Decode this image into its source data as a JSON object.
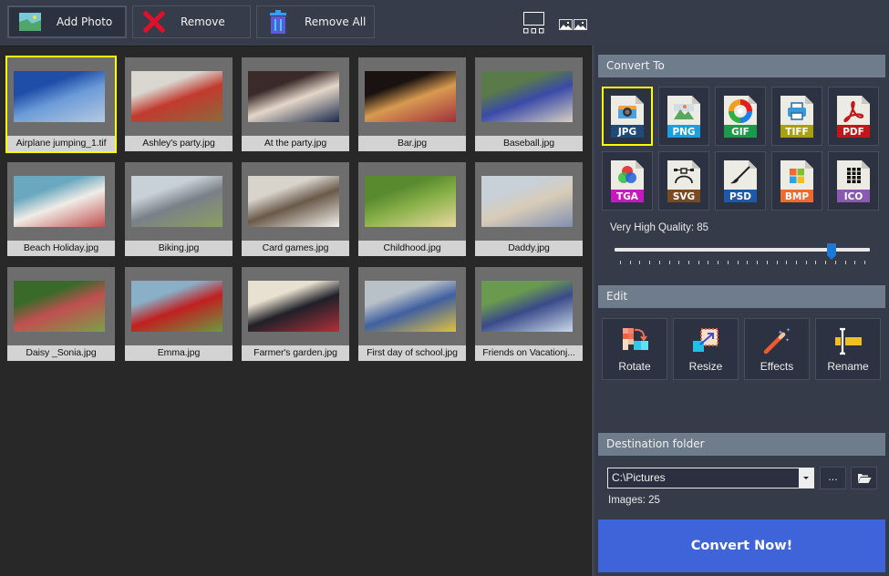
{
  "toolbar": {
    "add_photo": "Add Photo",
    "remove": "Remove",
    "remove_all": "Remove All",
    "view_icons": [
      "single-view-icon",
      "grid-view-icon"
    ]
  },
  "gallery": {
    "selected_index": 0,
    "items": [
      {
        "name": "Airplane jumping_1.tif",
        "colors": [
          "#1f4ea8",
          "#6c9bd8",
          "#b7c8e0"
        ]
      },
      {
        "name": "Ashley's party.jpg",
        "colors": [
          "#d9d7cf",
          "#c23a2e",
          "#8a6a3a"
        ]
      },
      {
        "name": "At the party.jpg",
        "colors": [
          "#3a2a2a",
          "#e4d6c8",
          "#1a2a4a"
        ]
      },
      {
        "name": "Bar.jpg",
        "colors": [
          "#1a1210",
          "#d89a50",
          "#a03040"
        ]
      },
      {
        "name": "Baseball.jpg",
        "colors": [
          "#5a7a4a",
          "#3a4aa8",
          "#d8d0c0"
        ]
      },
      {
        "name": "Beach Holiday.jpg",
        "colors": [
          "#6aa8c0",
          "#f0ece6",
          "#c05050"
        ]
      },
      {
        "name": "Biking.jpg",
        "colors": [
          "#c8d0d8",
          "#7a8088",
          "#8aa060"
        ]
      },
      {
        "name": "Card games.jpg",
        "colors": [
          "#d8d4cc",
          "#6a5a4a",
          "#f2f0ea"
        ]
      },
      {
        "name": "Childhood.jpg",
        "colors": [
          "#5a8a30",
          "#88b048",
          "#e8d8a0"
        ]
      },
      {
        "name": "Daddy.jpg",
        "colors": [
          "#c8d0d8",
          "#d8ccb8",
          "#8090b0"
        ]
      },
      {
        "name": "Daisy _Sonia.jpg",
        "colors": [
          "#3a6a2a",
          "#c05050",
          "#7aa048"
        ]
      },
      {
        "name": "Emma.jpg",
        "colors": [
          "#8ab0c8",
          "#c02020",
          "#6a9a40"
        ]
      },
      {
        "name": "Farmer's garden.jpg",
        "colors": [
          "#e8e0d0",
          "#202028",
          "#b0303a"
        ]
      },
      {
        "name": "First day of school.jpg",
        "colors": [
          "#b8c0c8",
          "#4060a0",
          "#e0c040"
        ]
      },
      {
        "name": "Friends on Vacationj...",
        "colors": [
          "#6a9a50",
          "#3a4a8a",
          "#c8d8e8"
        ]
      }
    ]
  },
  "panel": {
    "convert_to_header": "Convert To",
    "selected_format": "JPG",
    "formats": [
      {
        "label": "JPG",
        "color": "#1f4a7a",
        "icon": "camera-icon"
      },
      {
        "label": "PNG",
        "color": "#1aa0e0",
        "icon": "landscape-icon"
      },
      {
        "label": "GIF",
        "color": "#1a9a4a",
        "icon": "color-wheel-icon"
      },
      {
        "label": "TIFF",
        "color": "#a8a010",
        "icon": "printer-icon"
      },
      {
        "label": "PDF",
        "color": "#c01818",
        "icon": "acrobat-icon"
      },
      {
        "label": "TGA",
        "color": "#c818c0",
        "icon": "rgb-circles-icon"
      },
      {
        "label": "SVG",
        "color": "#7a4a20",
        "icon": "bezier-pen-icon"
      },
      {
        "label": "PSD",
        "color": "#1a5aa8",
        "icon": "brush-icon"
      },
      {
        "label": "BMP",
        "color": "#f06a30",
        "icon": "windows-logo-icon"
      },
      {
        "label": "ICO",
        "color": "#8a5ab0",
        "icon": "grid-dots-icon"
      }
    ],
    "quality_label": "Very High Quality: 85",
    "quality_value": 85,
    "quality_ticks": 26,
    "edit_header": "Edit",
    "edit_buttons": [
      {
        "label": "Rotate",
        "icon": "rotate-icon"
      },
      {
        "label": "Resize",
        "icon": "resize-icon"
      },
      {
        "label": "Effects",
        "icon": "magic-wand-icon"
      },
      {
        "label": "Rename",
        "icon": "rename-cursor-icon"
      }
    ],
    "destination_header": "Destination folder",
    "destination_value": "C:\\Pictures",
    "browse_label": "...",
    "images_count": "Images: 25",
    "convert_label": "Convert Now!"
  }
}
